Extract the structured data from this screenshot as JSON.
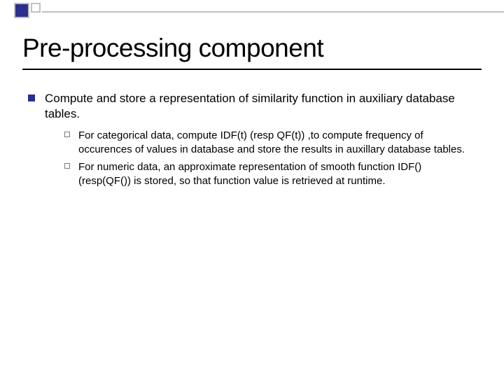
{
  "title": "Pre-processing component",
  "main_bullet": "Compute and store a representation of similarity function in auxiliary database tables.",
  "sub_bullets": [
    "For categorical data, compute IDF(t) (resp QF(t)) ,to compute frequency of occurences of values in database and store the results in auxillary database tables.",
    "For numeric data, an approximate representation of smooth function IDF() (resp(QF()) is stored, so that function value is retrieved at runtime."
  ]
}
